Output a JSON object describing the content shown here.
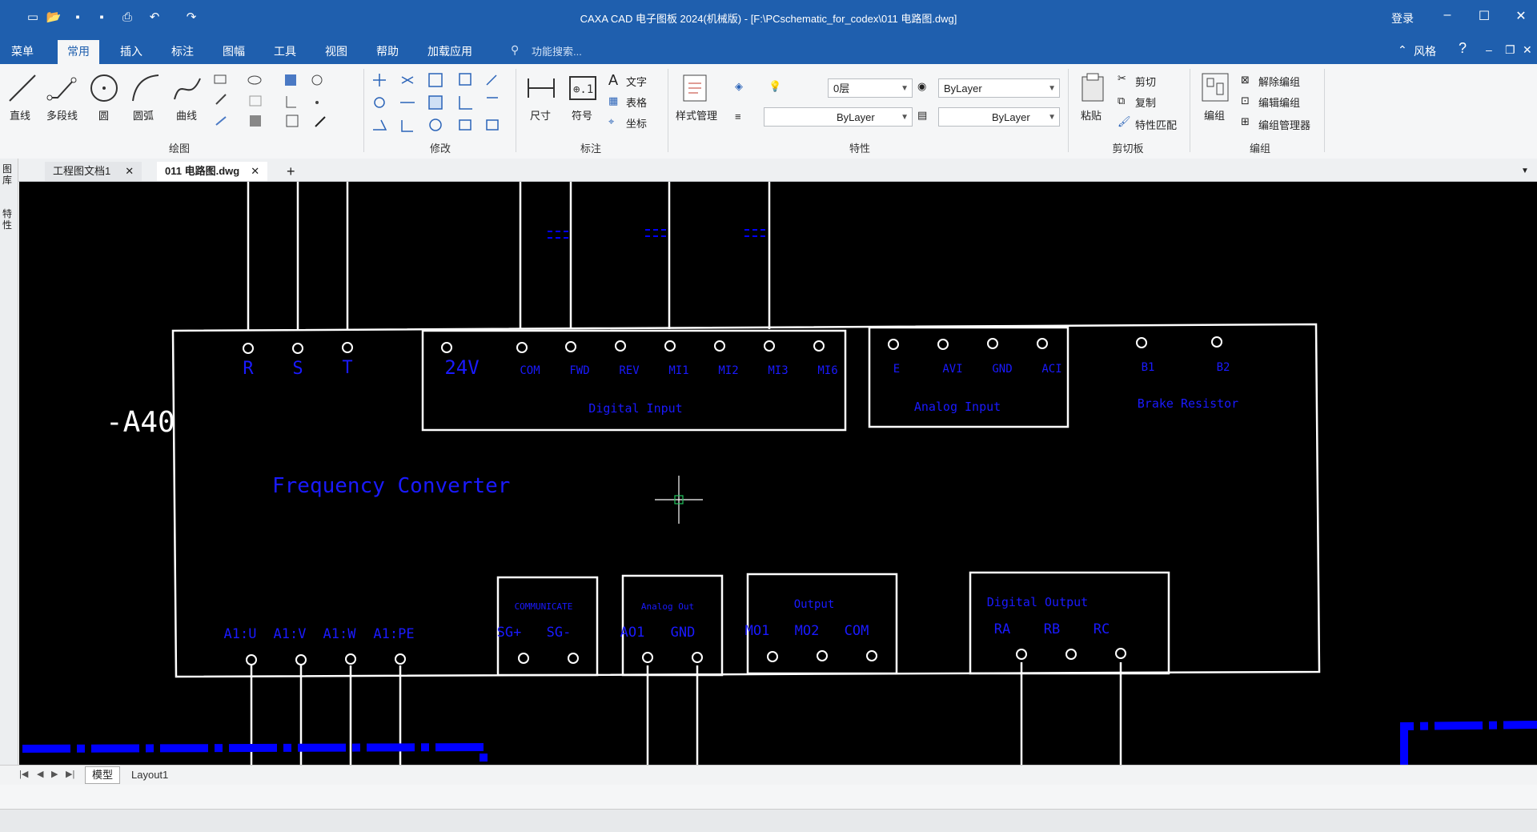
{
  "window": {
    "title": "CAXA CAD 电子图板 2024(机械版) - [F:\\PCschematic_for_codex\\011 电路图.dwg]",
    "login": "登录",
    "minimize": "–",
    "maximize": "☐",
    "close": "✕"
  },
  "menus": [
    "菜单",
    "常用",
    "插入",
    "标注",
    "图幅",
    "工具",
    "视图",
    "帮助",
    "加载应用"
  ],
  "search_placeholder": "功能搜索...",
  "style_label": "风格",
  "ribbon": {
    "draw_buttons": [
      "直线",
      "多段线",
      "圆",
      "圆弧",
      "曲线"
    ],
    "draw_group": "绘图",
    "modify_group": "修改",
    "annot_buttons": [
      "尺寸",
      "符号"
    ],
    "annot_small": [
      "文字",
      "表格",
      "坐标"
    ],
    "annot_group": "标注",
    "style_manager": "样式管理",
    "layer_value": "0层",
    "color_value": "ByLayer",
    "linetype_value": "ByLayer",
    "lineweight_value": "ByLayer",
    "props_group": "特性",
    "paste": "粘贴",
    "cut": "剪切",
    "copy": "复制",
    "match": "特性匹配",
    "clipboard_group": "剪切板",
    "group_btn": "编组",
    "ungroup": "解除编组",
    "edit_group": "编辑编组",
    "group_manager": "编组管理器",
    "group_group": "编组"
  },
  "doc_tabs": [
    "工程图文档1",
    "011 电路图.dwg"
  ],
  "left_strip": [
    "图库",
    "特性"
  ],
  "layout_tabs": [
    "模型",
    "Layout1"
  ],
  "drawing": {
    "designation": "-A40",
    "device_name": "Frequency Converter",
    "power_terminals": [
      "R",
      "S",
      "T"
    ],
    "digital_input_terminals": [
      "24V",
      "COM",
      "FWD",
      "REV",
      "MI1",
      "MI2",
      "MI3",
      "MI6"
    ],
    "digital_input_label": "Digital Input",
    "analog_input_terminals": [
      "E",
      "AVI",
      "GND",
      "ACI"
    ],
    "analog_input_label": "Analog Input",
    "brake_terminals": [
      "B1",
      "B2"
    ],
    "brake_label": "Brake Resistor",
    "output_terminals": [
      "A1:U",
      "A1:V",
      "A1:W",
      "A1:PE"
    ],
    "comm_label": "COMMUNICATE",
    "comm_terminals": [
      "SG+",
      "SG-"
    ],
    "analog_out_label": "Analog Out",
    "analog_out_terminals": [
      "AO1",
      "GND"
    ],
    "output_label": "Output",
    "output_box_terminals": [
      "MO1",
      "MO2",
      "COM"
    ],
    "digital_output_label": "Digital Output",
    "digital_output_terminals": [
      "RA",
      "RB",
      "RC"
    ]
  },
  "colors": {
    "accent": "#1f5fae",
    "canvas": "#000000",
    "wire": "#ffffff",
    "text": "#1a1aff",
    "dash": "#0000ff"
  }
}
